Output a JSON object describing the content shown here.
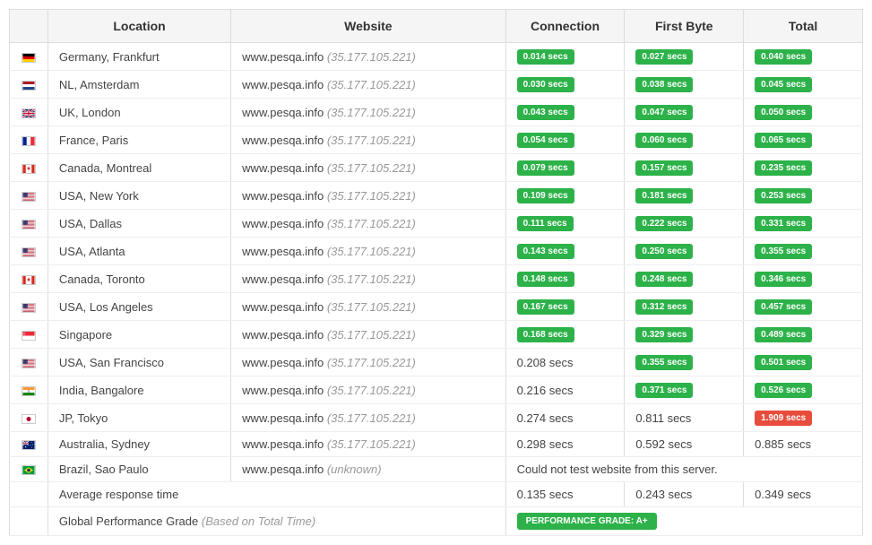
{
  "headers": {
    "flag": "",
    "location": "Location",
    "website": "Website",
    "connection": "Connection",
    "first_byte": "First Byte",
    "total": "Total"
  },
  "website": {
    "domain": "www.pesqa.info",
    "ip": "(35.177.105.221)",
    "unknown": "(unknown)"
  },
  "rows": [
    {
      "flag": "de",
      "location": "Germany, Frankfurt",
      "connection": {
        "text": "0.014 secs",
        "style": "green"
      },
      "first_byte": {
        "text": "0.027 secs",
        "style": "green"
      },
      "total": {
        "text": "0.040 secs",
        "style": "green"
      }
    },
    {
      "flag": "nl",
      "location": "NL, Amsterdam",
      "connection": {
        "text": "0.030 secs",
        "style": "green"
      },
      "first_byte": {
        "text": "0.038 secs",
        "style": "green"
      },
      "total": {
        "text": "0.045 secs",
        "style": "green"
      }
    },
    {
      "flag": "gb",
      "location": "UK, London",
      "connection": {
        "text": "0.043 secs",
        "style": "green"
      },
      "first_byte": {
        "text": "0.047 secs",
        "style": "green"
      },
      "total": {
        "text": "0.050 secs",
        "style": "green"
      }
    },
    {
      "flag": "fr",
      "location": "France, Paris",
      "connection": {
        "text": "0.054 secs",
        "style": "green"
      },
      "first_byte": {
        "text": "0.060 secs",
        "style": "green"
      },
      "total": {
        "text": "0.065 secs",
        "style": "green"
      }
    },
    {
      "flag": "ca",
      "location": "Canada, Montreal",
      "connection": {
        "text": "0.079 secs",
        "style": "green"
      },
      "first_byte": {
        "text": "0.157 secs",
        "style": "green"
      },
      "total": {
        "text": "0.235 secs",
        "style": "green"
      }
    },
    {
      "flag": "us",
      "location": "USA, New York",
      "connection": {
        "text": "0.109 secs",
        "style": "green"
      },
      "first_byte": {
        "text": "0.181 secs",
        "style": "green"
      },
      "total": {
        "text": "0.253 secs",
        "style": "green"
      }
    },
    {
      "flag": "us",
      "location": "USA, Dallas",
      "connection": {
        "text": "0.111 secs",
        "style": "green"
      },
      "first_byte": {
        "text": "0.222 secs",
        "style": "green"
      },
      "total": {
        "text": "0.331 secs",
        "style": "green"
      }
    },
    {
      "flag": "us",
      "location": "USA, Atlanta",
      "connection": {
        "text": "0.143 secs",
        "style": "green"
      },
      "first_byte": {
        "text": "0.250 secs",
        "style": "green"
      },
      "total": {
        "text": "0.355 secs",
        "style": "green"
      }
    },
    {
      "flag": "ca",
      "location": "Canada, Toronto",
      "connection": {
        "text": "0.148 secs",
        "style": "green"
      },
      "first_byte": {
        "text": "0.248 secs",
        "style": "green"
      },
      "total": {
        "text": "0.346 secs",
        "style": "green"
      }
    },
    {
      "flag": "us",
      "location": "USA, Los Angeles",
      "connection": {
        "text": "0.167 secs",
        "style": "green"
      },
      "first_byte": {
        "text": "0.312 secs",
        "style": "green"
      },
      "total": {
        "text": "0.457 secs",
        "style": "green"
      }
    },
    {
      "flag": "sg",
      "location": "Singapore",
      "connection": {
        "text": "0.168 secs",
        "style": "green"
      },
      "first_byte": {
        "text": "0.329 secs",
        "style": "green"
      },
      "total": {
        "text": "0.489 secs",
        "style": "green"
      }
    },
    {
      "flag": "us",
      "location": "USA, San Francisco",
      "connection": {
        "text": "0.208 secs",
        "style": "plain"
      },
      "first_byte": {
        "text": "0.355 secs",
        "style": "green"
      },
      "total": {
        "text": "0.501 secs",
        "style": "green"
      }
    },
    {
      "flag": "in",
      "location": "India, Bangalore",
      "connection": {
        "text": "0.216 secs",
        "style": "plain"
      },
      "first_byte": {
        "text": "0.371 secs",
        "style": "green"
      },
      "total": {
        "text": "0.526 secs",
        "style": "green"
      }
    },
    {
      "flag": "jp",
      "location": "JP, Tokyo",
      "connection": {
        "text": "0.274 secs",
        "style": "plain"
      },
      "first_byte": {
        "text": "0.811 secs",
        "style": "plain"
      },
      "total": {
        "text": "1.909 secs",
        "style": "red"
      }
    },
    {
      "flag": "au",
      "location": "Australia, Sydney",
      "connection": {
        "text": "0.298 secs",
        "style": "plain"
      },
      "first_byte": {
        "text": "0.592 secs",
        "style": "plain"
      },
      "total": {
        "text": "0.885 secs",
        "style": "plain"
      }
    }
  ],
  "error_row": {
    "flag": "br",
    "location": "Brazil, Sao Paulo",
    "message": "Could not test website from this server."
  },
  "summary": {
    "avg_label": "Average response time",
    "avg_connection": "0.135 secs",
    "avg_first_byte": "0.243 secs",
    "avg_total": "0.349 secs",
    "grade_label": "Global Performance Grade",
    "grade_sub": "(Based on Total Time)",
    "grade_badge": "PERFORMANCE GRADE:  A+"
  }
}
